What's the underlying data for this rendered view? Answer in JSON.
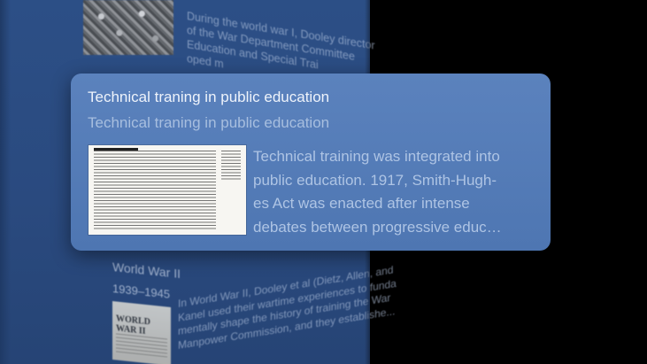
{
  "background": {
    "top_entry_text_lines": [
      "During the world war I, Dooley director",
      "of the War Department Committee",
      "Education and Special Trai",
      "oped m"
    ],
    "ww2_entry": {
      "title": "World War II",
      "years": "1939–1945",
      "photo_title": "WORLD WAR II",
      "text_lines": [
        "In World War II, Dooley et al (Dietz, Allen, and",
        "Kanel used their wartime experiences to funda",
        "mentally shape the history of training the War",
        "Manpower Commission, and they establishe..."
      ]
    }
  },
  "card": {
    "title": "Technical traning in public education",
    "subtitle": "Technical traning in public education",
    "image_name": "legislation-document-thumbnail",
    "description_lines": [
      "Technical training was integrated into",
      "public education. 1917, Smith-Hugh-",
      "es Act was enacted after intense",
      "debates between progressive educ…"
    ]
  },
  "colors": {
    "background": "#000000",
    "column": "#2c4f86",
    "card": "#5580bb",
    "card_title": "#eef3fb",
    "card_subtitle": "#a7bedf",
    "card_description": "#aec4e4"
  }
}
